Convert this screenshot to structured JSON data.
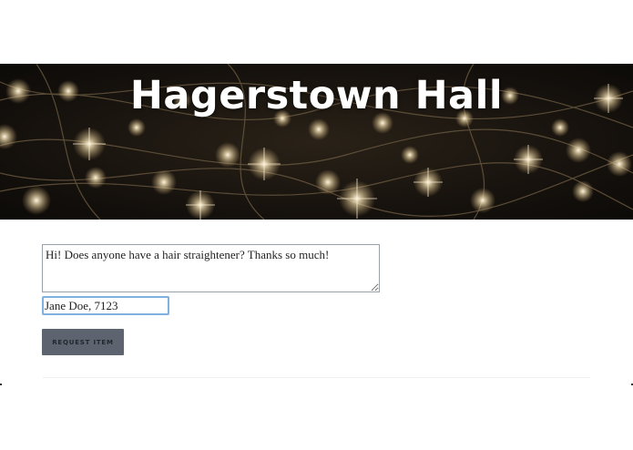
{
  "header": {
    "title": "Hagerstown Hall",
    "background_image": "string-lights-photo"
  },
  "form": {
    "message_value": "Hi! Does anyone have a hair straightener? Thanks so much!",
    "name_value": "Jane Doe, 7123",
    "submit_label": "REQUEST ITEM"
  },
  "colors": {
    "button_bg": "#5d6470",
    "focus_border": "#7fb0e0",
    "hero_bg": "#14100c"
  }
}
